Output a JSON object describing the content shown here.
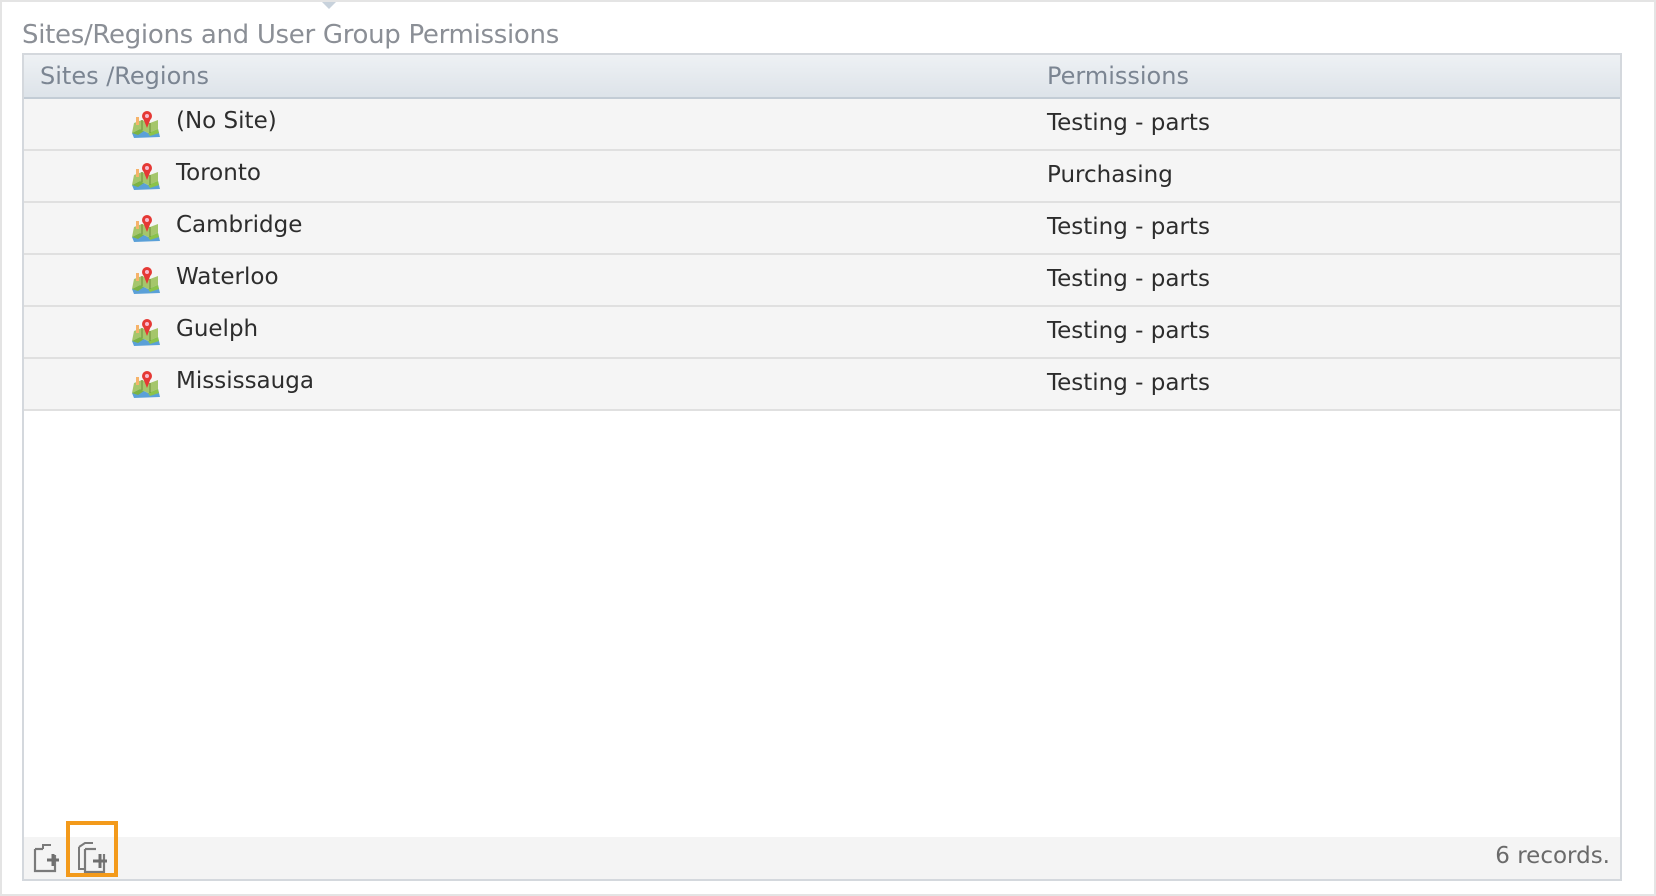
{
  "section": {
    "title": "Sites/Regions and User Group Permissions"
  },
  "grid": {
    "columns": {
      "sites": "Sites /Regions",
      "permissions": "Permissions"
    },
    "rows": [
      {
        "site": "(No Site)",
        "permission": "Testing - parts",
        "icon": "map-pin-icon"
      },
      {
        "site": "Toronto",
        "permission": "Purchasing",
        "icon": "map-pin-icon"
      },
      {
        "site": "Cambridge",
        "permission": "Testing - parts",
        "icon": "map-pin-icon"
      },
      {
        "site": "Waterloo",
        "permission": "Testing - parts",
        "icon": "map-pin-icon"
      },
      {
        "site": "Guelph",
        "permission": "Testing - parts",
        "icon": "map-pin-icon"
      },
      {
        "site": "Mississauga",
        "permission": "Testing - parts",
        "icon": "map-pin-icon"
      }
    ]
  },
  "footer": {
    "add_icon": "add-document-icon",
    "add_multiple_icon": "add-multiple-documents-icon",
    "records_label": "6 records."
  },
  "colors": {
    "highlight": "#f39a1b",
    "header_text": "#7b8592",
    "row_background": "#f5f5f5"
  }
}
